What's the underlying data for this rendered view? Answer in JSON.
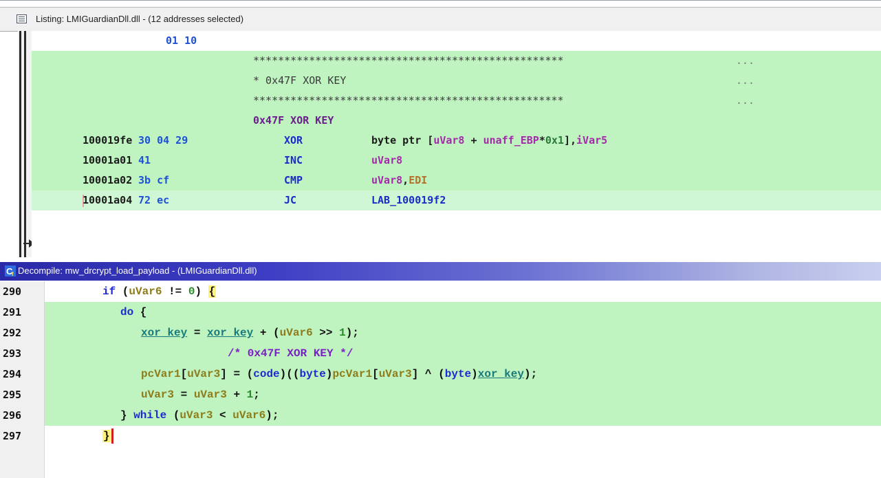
{
  "listing": {
    "title": "Listing:  LMIGuardianDll.dll - (12 addresses selected)",
    "rows": [
      {
        "bytes": "01 10"
      },
      {
        "stars": "**************************************************",
        "dots": "..."
      },
      {
        "comment": "* 0x47F XOR KEY",
        "dots": "..."
      },
      {
        "stars": "**************************************************",
        "dots": "..."
      },
      {
        "label": "0x47F XOR KEY"
      },
      {
        "addr": "100019fe",
        "bytes": "30 04 29",
        "mnemonic": "XOR",
        "op_prefix": "byte ptr [",
        "op_var1": "uVar8",
        "op_mid": " + ",
        "op_var2": "unaff_EBP",
        "op_mult": "*",
        "op_num": "0x1",
        "op_suffix": "],",
        "op_var3": "iVar5"
      },
      {
        "addr": "10001a01",
        "bytes": "41",
        "mnemonic": "INC",
        "op_var1": "uVar8"
      },
      {
        "addr": "10001a02",
        "bytes": "3b cf",
        "mnemonic": "CMP",
        "op_var1": "uVar8",
        "op_comma": ",",
        "op_reg": "EDI"
      },
      {
        "addr": "10001a04",
        "bytes": "72 ec",
        "mnemonic": "JC",
        "op_label": "LAB_100019f2"
      }
    ]
  },
  "decompile": {
    "title": "Decompile: mw_drcrypt_load_payload -  (LMIGuardianDll.dll)",
    "line_numbers": [
      "290",
      "291",
      "292",
      "293",
      "294",
      "295",
      "296",
      "297"
    ],
    "lines": {
      "l290": {
        "kw_if": "if",
        "p1": " (",
        "v": "uVar6",
        "op": " != ",
        "num": "0",
        "p2": ") ",
        "brace": "{"
      },
      "l291": {
        "kw_do": "do",
        "rest": " {"
      },
      "l292": {
        "g1": "xor_key",
        "eq": " = ",
        "g2": "xor_key",
        "plus": " + (",
        "v": "uVar6",
        "shr": " >> ",
        "num": "1",
        "end": ");"
      },
      "l293": {
        "comment": "/* 0x47F XOR KEY */"
      },
      "l294": {
        "v1": "pcVar1",
        "b1": "[",
        "v2": "uVar3",
        "b2": "] = (",
        "t1": "code",
        "b3": ")((",
        "t2": "byte",
        "b4": ")",
        "v3": "pcVar1",
        "b5": "[",
        "v4": "uVar3",
        "b6": "] ^ (",
        "t3": "byte",
        "b7": ")",
        "g": "xor_key",
        "b8": ");"
      },
      "l295": {
        "v1": "uVar3",
        "eq": " = ",
        "v2": "uVar3",
        "plus": " + ",
        "num": "1",
        "end": ";"
      },
      "l296": {
        "b1": "} ",
        "kw_while": "while",
        "p1": " (",
        "v1": "uVar3",
        "lt": " < ",
        "v2": "uVar6",
        "end": ");"
      },
      "l297": {
        "brace": "}"
      }
    }
  }
}
